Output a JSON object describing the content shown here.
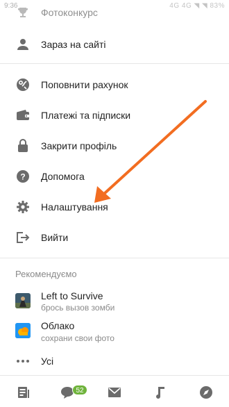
{
  "status_bar": {
    "time": "9:36",
    "indicators": "4G  4G  ◥  ◥  83%"
  },
  "menu_top": [
    {
      "label": "Фотоконкурс",
      "icon": "trophy-icon"
    },
    {
      "label": "Зараз на сайті",
      "icon": "person-icon"
    }
  ],
  "menu_main": [
    {
      "label": "Поповнити рахунок",
      "icon": "ok-currency-icon"
    },
    {
      "label": "Платежі та підписки",
      "icon": "wallet-icon"
    },
    {
      "label": "Закрити профіль",
      "icon": "lock-icon"
    },
    {
      "label": "Допомога",
      "icon": "help-icon"
    },
    {
      "label": "Налаштування",
      "icon": "gear-icon"
    },
    {
      "label": "Вийти",
      "icon": "logout-icon"
    }
  ],
  "recommended": {
    "header": "Рекомендуємо",
    "apps": [
      {
        "title": "Left to Survive",
        "subtitle": "брось вызов зомби",
        "icon": "game-icon"
      },
      {
        "title": "Облако",
        "subtitle": "сохрани свои фото",
        "icon": "cloud-app-icon"
      }
    ],
    "all_label": "Усі"
  },
  "tabbar": {
    "items": [
      "feed-icon",
      "messages-icon",
      "mail-icon",
      "music-icon",
      "discover-icon"
    ],
    "messages_badge": "52"
  },
  "colors": {
    "icon_gray": "#6b6b6b",
    "badge_green": "#6fb33c",
    "annotation_arrow": "#f26d21"
  }
}
